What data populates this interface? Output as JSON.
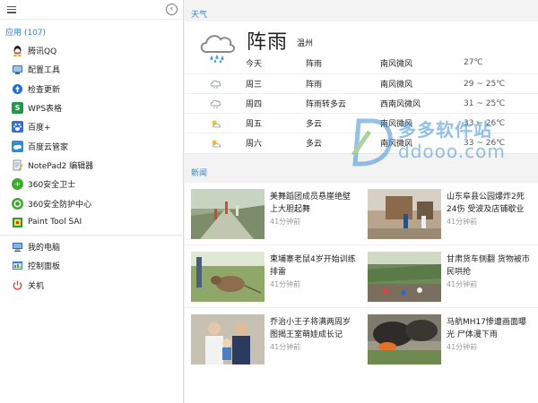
{
  "sidebar": {
    "apps_header": "应用 (107)",
    "apps": [
      {
        "label": "腾讯QQ",
        "icon": "qq-icon"
      },
      {
        "label": "配置工具",
        "icon": "config-tool-icon"
      },
      {
        "label": "检查更新",
        "icon": "update-icon"
      },
      {
        "label": "WPS表格",
        "icon": "wps-sheet-icon"
      },
      {
        "label": "百度+",
        "icon": "baidu-plus-icon"
      },
      {
        "label": "百度云管家",
        "icon": "baidu-cloud-icon"
      },
      {
        "label": "NotePad2 编辑器",
        "icon": "notepad2-icon"
      },
      {
        "label": "360安全卫士",
        "icon": "360-guard-icon"
      },
      {
        "label": "360安全防护中心",
        "icon": "360-protect-icon"
      },
      {
        "label": "Paint Tool SAI",
        "icon": "painttool-sai-icon"
      }
    ],
    "system": [
      {
        "label": "我的电脑",
        "icon": "computer-icon"
      },
      {
        "label": "控制面板",
        "icon": "control-panel-icon"
      },
      {
        "label": "关机",
        "icon": "power-icon"
      }
    ]
  },
  "weather": {
    "section_label": "天气",
    "condition": "阵雨",
    "city": "温州",
    "rows": [
      {
        "day": "今天",
        "cond": "阵雨",
        "wind": "南风微风",
        "temp": "27℃",
        "icon": "none"
      },
      {
        "day": "周三",
        "cond": "阵雨",
        "wind": "南风微风",
        "temp": "29 ~ 25℃",
        "icon": "rain-cloud-icon"
      },
      {
        "day": "周四",
        "cond": "阵雨转多云",
        "wind": "西南风微风",
        "temp": "31 ~ 25℃",
        "icon": "rain-cloud-icon"
      },
      {
        "day": "周五",
        "cond": "多云",
        "wind": "南风微风",
        "temp": "33 ~ 26℃",
        "icon": "partly-cloudy-icon"
      },
      {
        "day": "周六",
        "cond": "多云",
        "wind": "南风微风",
        "temp": "33 ~ 26℃",
        "icon": "partly-cloudy-icon"
      }
    ]
  },
  "news": {
    "section_label": "新闻",
    "items": [
      {
        "title": "美舞蹈团成员悬崖绝壁上大胆起舞",
        "time": "41分钟前"
      },
      {
        "title": "山东阜县公园爆炸2死24伤 受波及店铺歇业",
        "time": "41分钟前"
      },
      {
        "title": "柬埔寨老鼠4岁开始训练排雷",
        "time": "41分钟前"
      },
      {
        "title": "甘肃货车侧翻 货物被市民哄抢",
        "time": "41分钟前"
      },
      {
        "title": "乔治小王子将满两周岁 图揭王室萌娃成长记",
        "time": "41分钟前"
      },
      {
        "title": "马航MH17惨遭画面曝光 尸体漫下雨",
        "time": "41分钟前"
      }
    ]
  },
  "watermark": {
    "cn": "多多软件站",
    "en": "ddooo.com"
  }
}
